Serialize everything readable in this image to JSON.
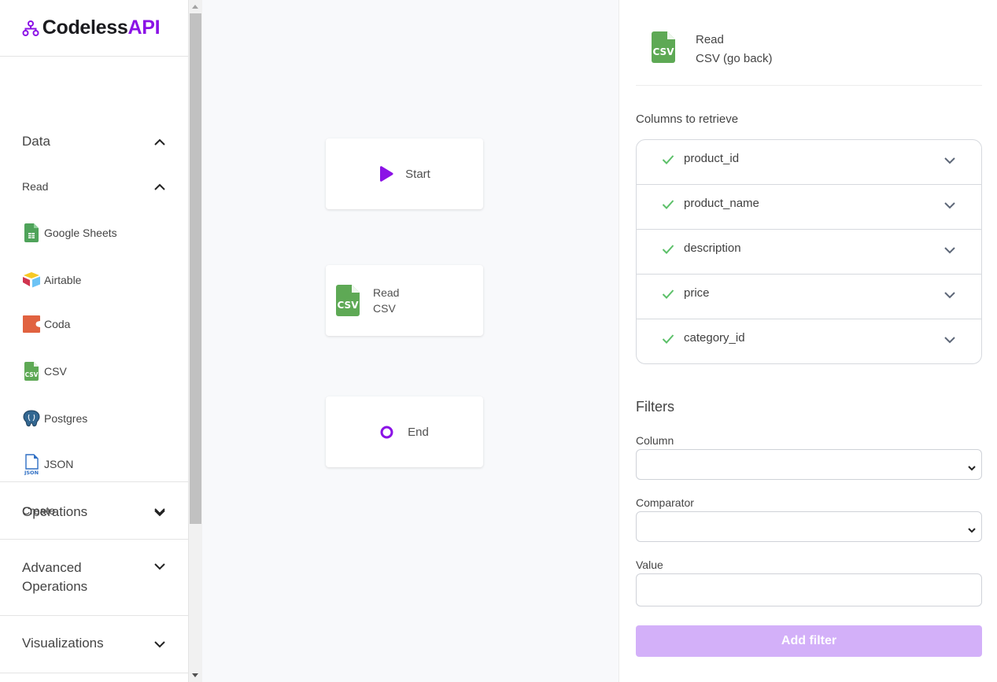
{
  "brand": {
    "name_main": "Codeless",
    "name_accent": "API",
    "accent_color": "#8b12e6"
  },
  "sidebar": {
    "sections": [
      {
        "label": "Data",
        "expanded": true,
        "subsections": [
          {
            "label": "Read",
            "expanded": true,
            "items": [
              {
                "label": "Google Sheets",
                "icon": "google-sheets-icon"
              },
              {
                "label": "Airtable",
                "icon": "airtable-icon"
              },
              {
                "label": "Coda",
                "icon": "coda-icon"
              },
              {
                "label": "CSV",
                "icon": "csv-icon"
              },
              {
                "label": "Postgres",
                "icon": "postgres-icon"
              },
              {
                "label": "JSON",
                "icon": "json-icon"
              }
            ]
          },
          {
            "label": "Create",
            "expanded": false
          }
        ]
      },
      {
        "label": "Operations",
        "expanded": false
      },
      {
        "label": "Advanced Operations",
        "expanded": false
      },
      {
        "label": "Visualizations",
        "expanded": false
      }
    ]
  },
  "canvas": {
    "nodes": [
      {
        "label": "Start",
        "icon": "play-icon"
      },
      {
        "line1": "Read",
        "line2": "CSV",
        "icon": "csv-icon"
      },
      {
        "label": "End",
        "icon": "circle-icon"
      }
    ]
  },
  "panel": {
    "header": {
      "line1": "Read",
      "line2": "CSV (go back)"
    },
    "columns_label": "Columns to retrieve",
    "columns": [
      {
        "name": "product_id",
        "checked": true
      },
      {
        "name": "product_name",
        "checked": true
      },
      {
        "name": "description",
        "checked": true
      },
      {
        "name": "price",
        "checked": true
      },
      {
        "name": "category_id",
        "checked": true
      }
    ],
    "filters": {
      "title": "Filters",
      "column_label": "Column",
      "column_value": "",
      "comparator_label": "Comparator",
      "comparator_value": "",
      "value_label": "Value",
      "value_value": "",
      "add_button": "Add filter",
      "add_button_color": "#d3b0f9"
    }
  }
}
